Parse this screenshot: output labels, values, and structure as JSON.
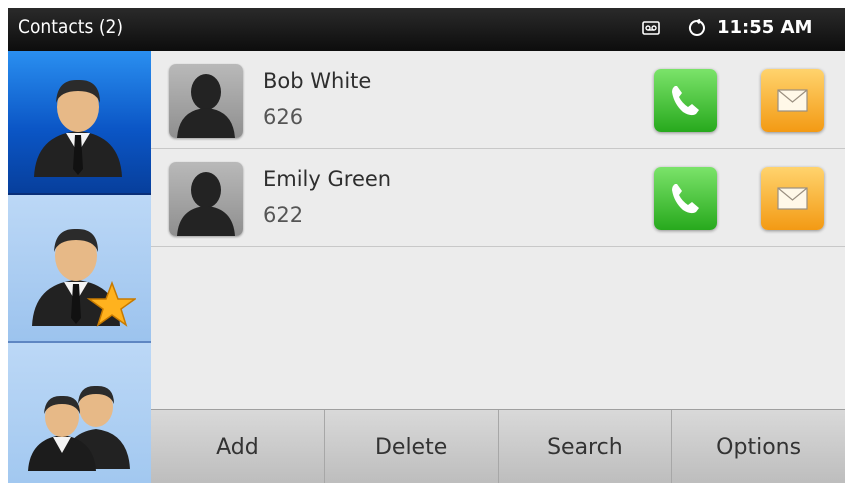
{
  "statusbar": {
    "title": "Contacts (2)",
    "time": "11:55 AM",
    "icons": [
      "voicemail-icon",
      "network-icon"
    ]
  },
  "sidebar": {
    "tabs": [
      {
        "icon": "contact-person-icon",
        "selected": true
      },
      {
        "icon": "favorite-contacts-icon",
        "selected": false
      },
      {
        "icon": "group-contacts-icon",
        "selected": false
      }
    ]
  },
  "contacts": [
    {
      "name": "Bob White",
      "number": "626",
      "avatar_icon": "silhouette-icon",
      "actions": [
        "phone-icon",
        "envelope-icon"
      ]
    },
    {
      "name": "Emily Green",
      "number": "622",
      "avatar_icon": "silhouette-icon",
      "actions": [
        "phone-icon",
        "envelope-icon"
      ]
    }
  ],
  "softkeys": [
    "Add",
    "Delete",
    "Search",
    "Options"
  ],
  "colors": {
    "selected_tab": "#0b56c6",
    "tab": "#a9cdf2",
    "call": "#2bb52a",
    "message": "#f5a623"
  }
}
